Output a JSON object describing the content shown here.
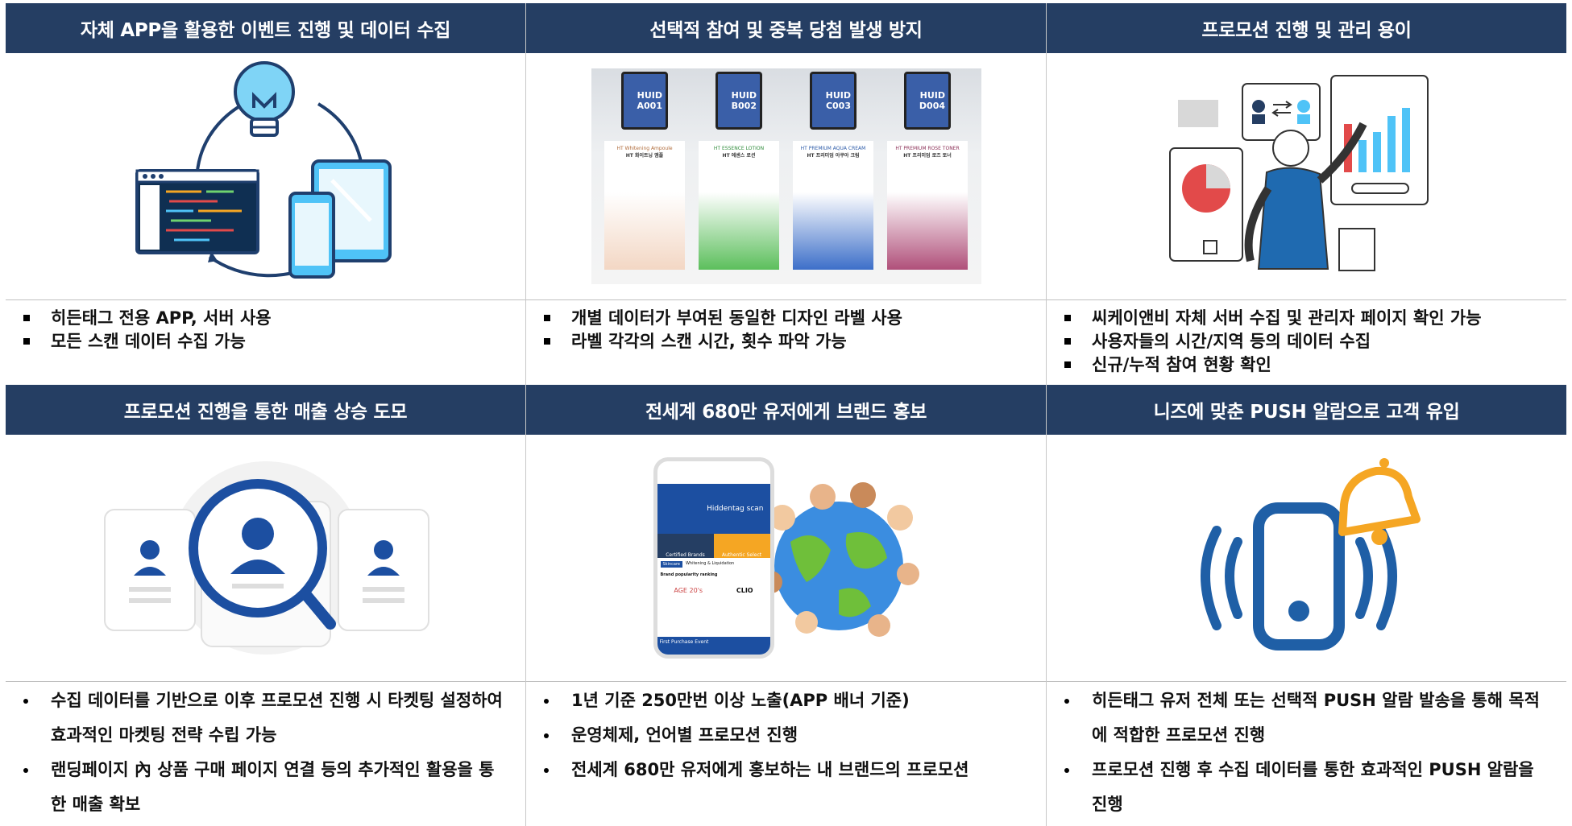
{
  "top": [
    {
      "title": "자체 APP을 활용한 이벤트 진행 및 데이터 수집",
      "bullets": [
        "히든태그 전용 APP, 서버 사용",
        "모든 스캔 데이터 수집 가능"
      ]
    },
    {
      "title": "선택적 참여 및 중복 당첨 발생 방지",
      "bullets": [
        "개별 데이터가 부여된 동일한 디자인 라벨 사용",
        "라벨 각각의 스캔 시간, 횟수 파악 가능"
      ],
      "phones": [
        {
          "l1": "HUID",
          "l2": "A001"
        },
        {
          "l1": "HUID",
          "l2": "B002"
        },
        {
          "l1": "HUID",
          "l2": "C003"
        },
        {
          "l1": "HUID",
          "l2": "D004"
        }
      ],
      "products": [
        {
          "name": "HT Whitening Ampoule",
          "kr": "HT 화이트닝 앰플"
        },
        {
          "name": "HT ESSENCE LOTION",
          "kr": "HT 에센스 로션"
        },
        {
          "name": "HT PREMIUM AQUA CREAM",
          "kr": "HT 프리미엄 아쿠아 크림"
        },
        {
          "name": "HT PREMIUM ROSE TONER",
          "kr": "HT 프리미엄 로즈 토너"
        }
      ]
    },
    {
      "title": "프로모션 진행 및 관리 용이",
      "bullets": [
        "씨케이앤비 자체 서버 수집 및 관리자 페이지 확인 가능",
        "사용자들의 시간/지역 등의 데이터 수집",
        "신규/누적 참여 현황 확인"
      ]
    }
  ],
  "bottom": [
    {
      "title": "프로모션 진행을 통한 매출 상승 도모",
      "bullets": [
        "수집 데이터를 기반으로 이후 프로모션 진행 시 타켓팅 설정하여 효과적인 마켓팅 전략 수립 가능",
        "랜딩페이지 內 상품 구매 페이지 연결 등의 추가적인 활용을 통한 매출 확보"
      ]
    },
    {
      "title": "전세계 680만 유저에게 브랜드 홍보",
      "bullets": [
        "1년 기준 250만번 이상 노출(APP 배너 기준)",
        "운영체제, 언어별 프로모션 진행",
        "전세계 680만 유저에게 홍보하는 내 브랜드의 프로모션"
      ],
      "app": {
        "scan_label": "Hiddentag scan",
        "tile1": "Certified Brands",
        "tile2": "Authentic Select",
        "chips": [
          "Skincare",
          "Whitening & Liquidation"
        ],
        "ranking": "Brand popularity ranking",
        "brands": [
          "AGE 20's",
          "CLIO"
        ],
        "event": "First Purchase Event"
      }
    },
    {
      "title": "니즈에 맞춘 PUSH 알람으로 고객 유입",
      "bullets": [
        "히든태그 유저 전체 또는 선택적 PUSH 알람 발송을 통해 목적에 적합한 프로모션 진행",
        "프로모션 진행 후 수집 데이터를 통한 효과적인 PUSH 알람을 진행"
      ]
    }
  ],
  "colors": {
    "header_bg": "#253e63",
    "accent_blue": "#1c4fa1",
    "light_blue": "#4fc3f7",
    "bell_orange": "#f5a623",
    "phone_blue": "#1f5fa6"
  }
}
